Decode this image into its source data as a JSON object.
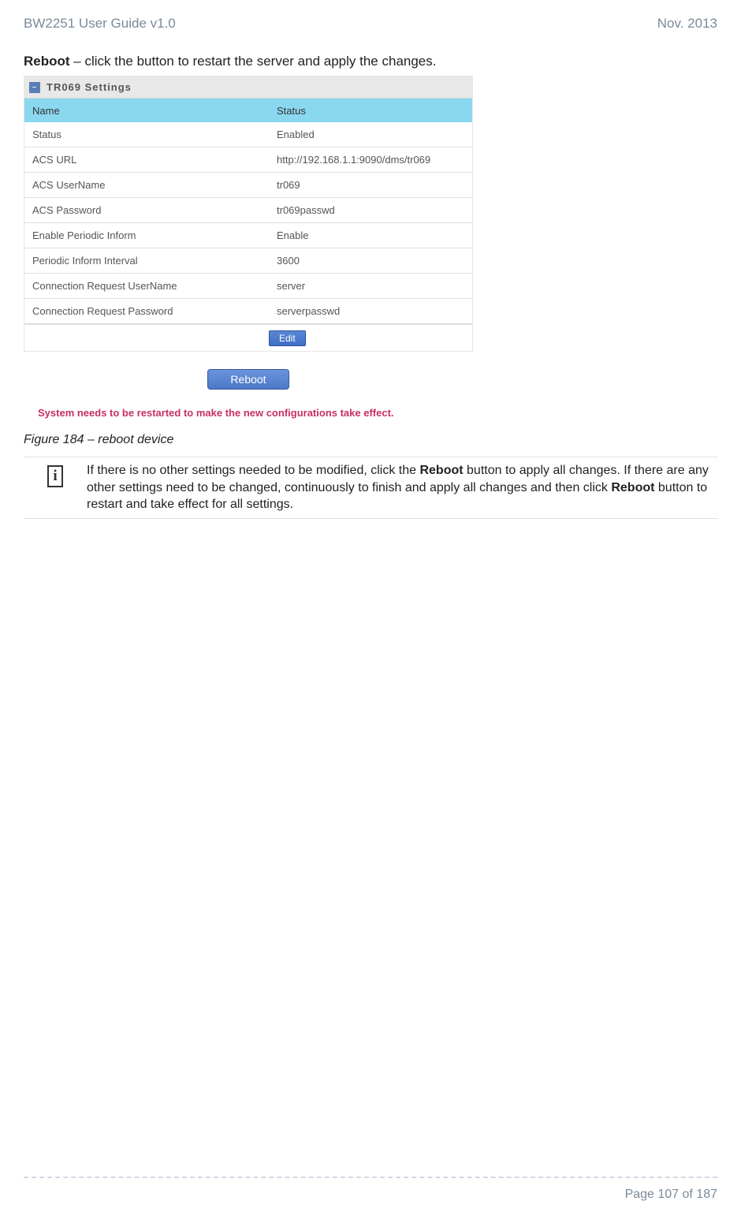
{
  "header": {
    "doc_title": "BW2251 User Guide v1.0",
    "date": "Nov.  2013"
  },
  "reboot_desc": {
    "bold": "Reboot",
    "rest": " – click the button to restart the server and apply the changes."
  },
  "panel": {
    "title": "TR069 Settings",
    "columns": {
      "c1": "Name",
      "c2": "Status"
    },
    "rows": [
      {
        "label": "Status",
        "value": "Enabled"
      },
      {
        "label": "ACS URL",
        "value": "http://192.168.1.1:9090/dms/tr069"
      },
      {
        "label": "ACS UserName",
        "value": "tr069"
      },
      {
        "label": "ACS Password",
        "value": "tr069passwd"
      },
      {
        "label": "Enable Periodic Inform",
        "value": "Enable"
      },
      {
        "label": "Periodic Inform Interval",
        "value": "3600"
      },
      {
        "label": "Connection Request UserName",
        "value": "server"
      },
      {
        "label": "Connection Request Password",
        "value": "serverpasswd"
      }
    ],
    "edit_btn": "Edit",
    "reboot_btn": "Reboot",
    "warning": "System needs to be restarted to make the new configurations take effect."
  },
  "caption": "Figure 184 – reboot device",
  "info": {
    "p1a": "If there is no other settings needed to be modified, click the ",
    "p1b": "Reboot",
    "p1c": " button to apply all changes. If there are any other settings need to be changed, continuously to finish and apply all changes and then click ",
    "p1d": "Reboot",
    "p1e": " button to restart and take effect  for all settings."
  },
  "footer": "Page 107 of 187"
}
